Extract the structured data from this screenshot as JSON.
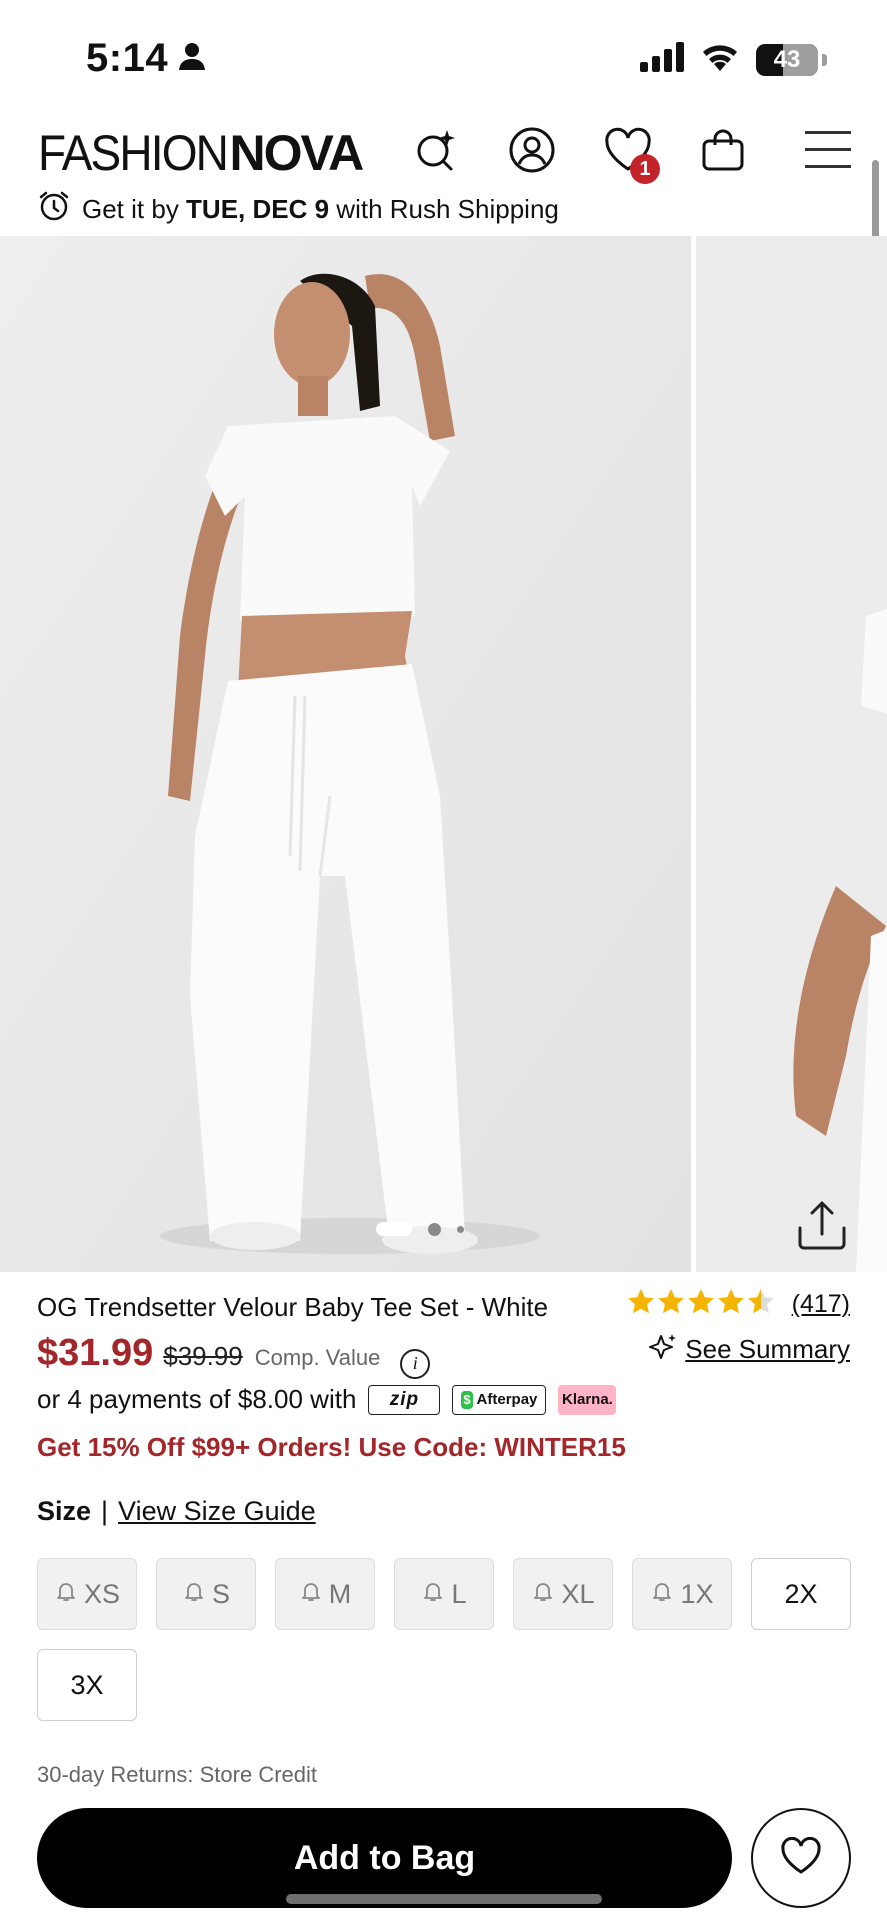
{
  "status_bar": {
    "time": "5:14",
    "battery_level": "43"
  },
  "header": {
    "logo_light": "FASHION",
    "logo_bold": "NOVA",
    "wishlist_count": "1",
    "shipping_prefix": "Get it by ",
    "shipping_date": "TUE, DEC 9",
    "shipping_suffix": " with Rush Shipping"
  },
  "gallery": {
    "image_count": 3,
    "active_index": 0
  },
  "product": {
    "title": "OG Trendsetter Velour Baby Tee Set - White",
    "rating": 4.5,
    "rating_count": "(417)",
    "sale_price": "$31.99",
    "original_price": "$39.99",
    "comp_value_label": "Comp. Value",
    "see_summary_label": "See Summary",
    "installments_text": "or 4 payments of $8.00 with",
    "payment_options": [
      "zip",
      "Afterpay",
      "Klarna."
    ],
    "promo_text": "Get 15% Off $99+ Orders! Use Code: WINTER15",
    "sale_color": "#a3262a"
  },
  "sizes": {
    "label": "Size",
    "separator": "|",
    "guide_label": "View Size Guide",
    "options": [
      {
        "label": "XS",
        "available": false
      },
      {
        "label": "S",
        "available": false
      },
      {
        "label": "M",
        "available": false
      },
      {
        "label": "L",
        "available": false
      },
      {
        "label": "XL",
        "available": false
      },
      {
        "label": "1X",
        "available": false
      },
      {
        "label": "2X",
        "available": true
      },
      {
        "label": "3X",
        "available": true
      }
    ]
  },
  "returns_text": "30-day Returns: Store Credit",
  "actions": {
    "add_to_bag_label": "Add to Bag"
  }
}
